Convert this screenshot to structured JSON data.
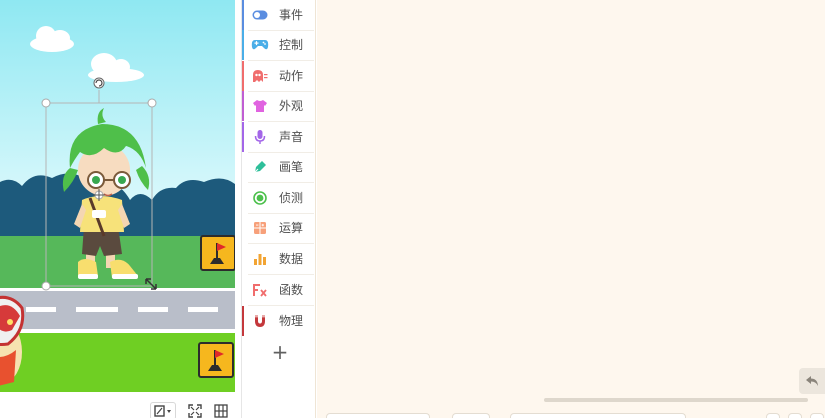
{
  "categories": [
    {
      "label": "事件",
      "icon": "toggle-icon",
      "color": "#5a8de0",
      "accent": "#ffffff"
    },
    {
      "label": "控制",
      "icon": "gamepad-icon",
      "color": "#4aaee8",
      "accent": "#4aaee8"
    },
    {
      "label": "动作",
      "icon": "ghost-icon",
      "color": "#f06d6d",
      "accent": "#f06d6d"
    },
    {
      "label": "外观",
      "icon": "shirt-icon",
      "color": "#e063e0",
      "accent": "#c05ed3"
    },
    {
      "label": "声音",
      "icon": "microphone-icon",
      "color": "#a366e8",
      "accent": "#a366e8"
    },
    {
      "label": "画笔",
      "icon": "pen-icon",
      "color": "#2ebf9a",
      "accent": "#ffffff"
    },
    {
      "label": "侦测",
      "icon": "radar-icon",
      "color": "#4cc04c",
      "accent": "#ffffff"
    },
    {
      "label": "运算",
      "icon": "calculator-icon",
      "color": "#f7a07a",
      "accent": "#ffffff"
    },
    {
      "label": "数据",
      "icon": "bar-chart-icon",
      "color": "#f2a433",
      "accent": "#ffffff"
    },
    {
      "label": "函数",
      "icon": "function-icon",
      "color": "#f06d6d",
      "accent": "#ffffff"
    },
    {
      "label": "物理",
      "icon": "magnet-icon",
      "color": "#c4383c",
      "accent": "#c4383c"
    }
  ],
  "add_category_label": "+",
  "stage_tools": [
    "screen-mode-icon",
    "fullscreen-icon",
    "grid-icon"
  ]
}
